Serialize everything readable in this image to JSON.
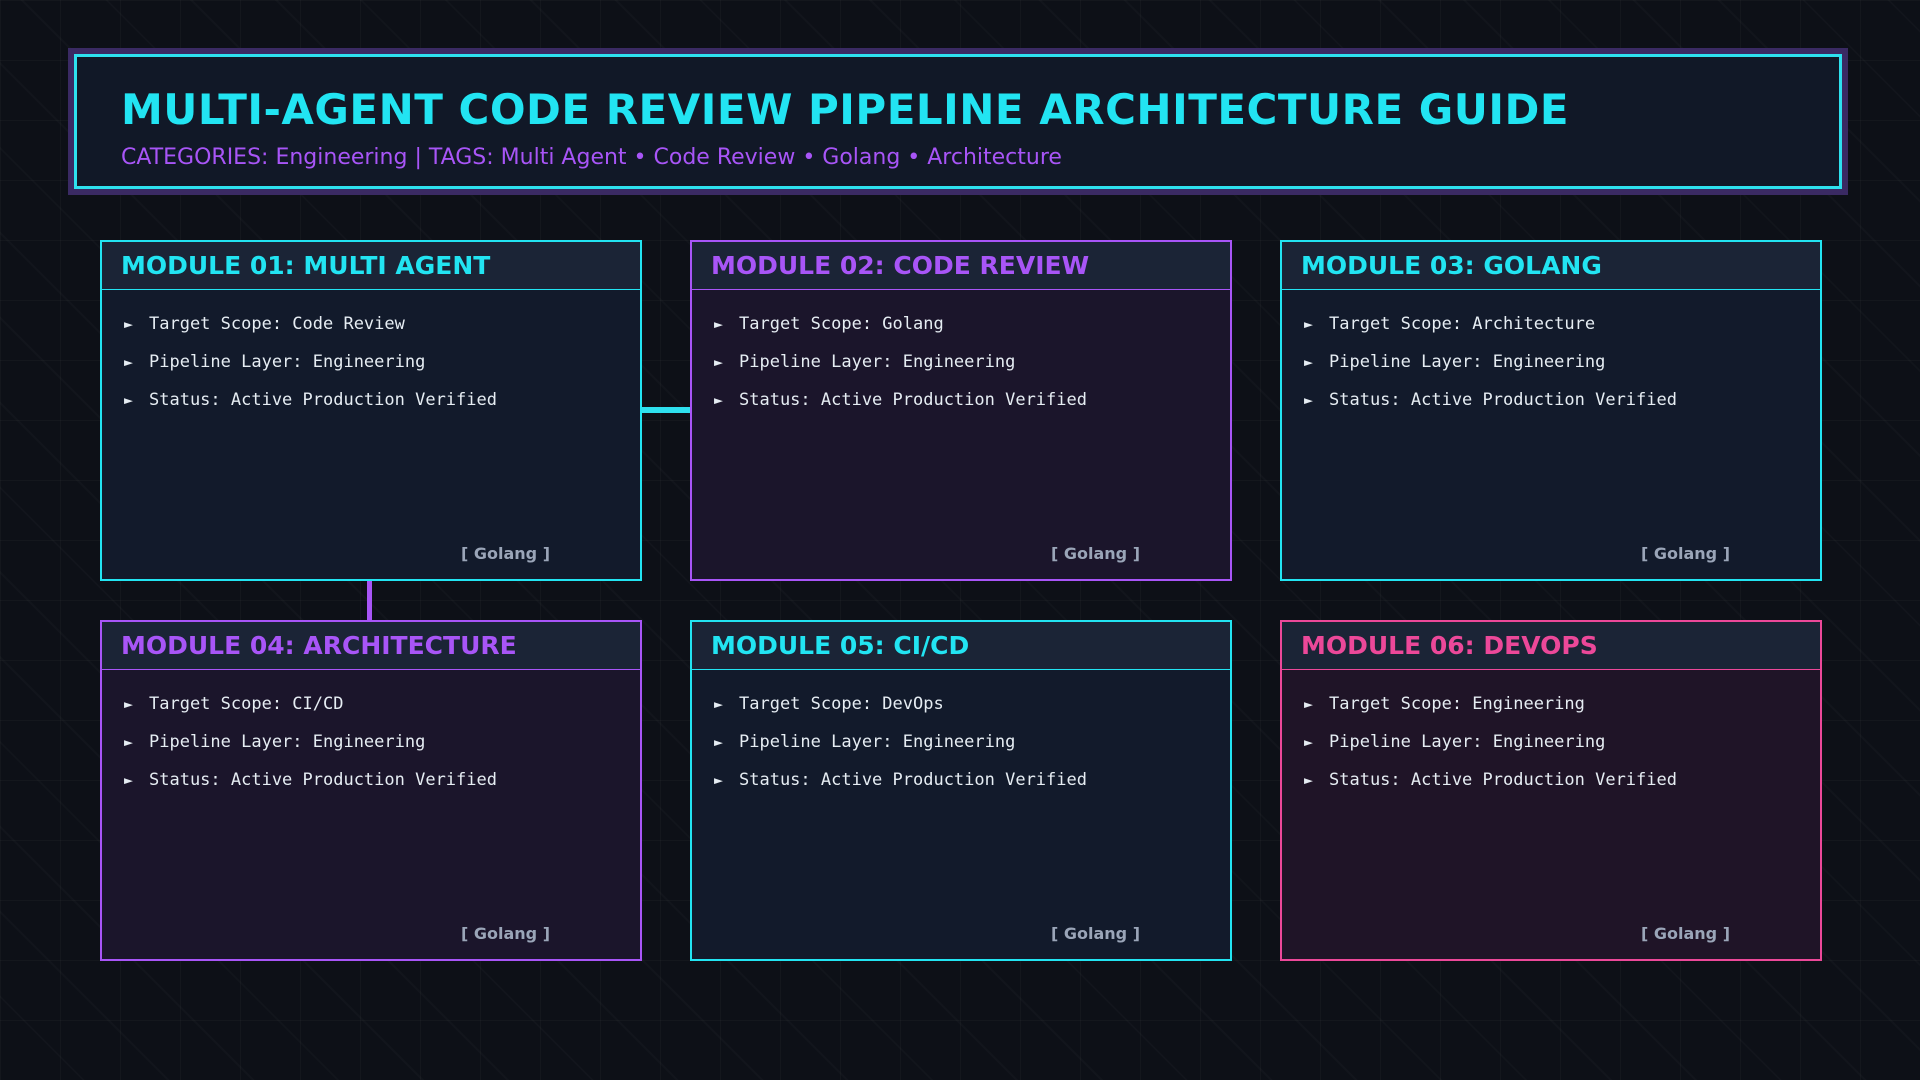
{
  "header": {
    "title": "MULTI-AGENT CODE REVIEW PIPELINE ARCHITECTURE GUIDE",
    "subtitle": "CATEGORIES: Engineering | TAGS: Multi Agent • Code Review • Golang • Architecture"
  },
  "colors": {
    "cyan": "#22e4f2",
    "purple": "#a855f7",
    "pink": "#ec4899"
  },
  "bullet_icon": "right-pointer-icon",
  "bullet_glyph": "►",
  "modules": [
    {
      "title": "MODULE 01: MULTI AGENT",
      "accent": "cyan",
      "lines": [
        "Target Scope: Code Review",
        "Pipeline Layer: Engineering",
        "Status: Active Production Verified"
      ],
      "tag": "[ Golang ]"
    },
    {
      "title": "MODULE 02: CODE REVIEW",
      "accent": "purple",
      "lines": [
        "Target Scope: Golang",
        "Pipeline Layer: Engineering",
        "Status: Active Production Verified"
      ],
      "tag": "[ Golang ]"
    },
    {
      "title": "MODULE 03: GOLANG",
      "accent": "cyan",
      "lines": [
        "Target Scope: Architecture",
        "Pipeline Layer: Engineering",
        "Status: Active Production Verified"
      ],
      "tag": "[ Golang ]"
    },
    {
      "title": "MODULE 04: ARCHITECTURE",
      "accent": "purple",
      "lines": [
        "Target Scope: CI/CD",
        "Pipeline Layer: Engineering",
        "Status: Active Production Verified"
      ],
      "tag": "[ Golang ]"
    },
    {
      "title": "MODULE 05: CI/CD",
      "accent": "cyan",
      "lines": [
        "Target Scope: DevOps",
        "Pipeline Layer: Engineering",
        "Status: Active Production Verified"
      ],
      "tag": "[ Golang ]"
    },
    {
      "title": "MODULE 06: DEVOPS",
      "accent": "pink",
      "lines": [
        "Target Scope: Engineering",
        "Pipeline Layer: Engineering",
        "Status: Active Production Verified"
      ],
      "tag": "[ Golang ]"
    }
  ],
  "connections": [
    {
      "from": "MODULE 01: MULTI AGENT",
      "to": "MODULE 02: CODE REVIEW",
      "color": "cyan"
    },
    {
      "from": "MODULE 01: MULTI AGENT",
      "to": "MODULE 04: ARCHITECTURE",
      "color": "purple"
    }
  ]
}
